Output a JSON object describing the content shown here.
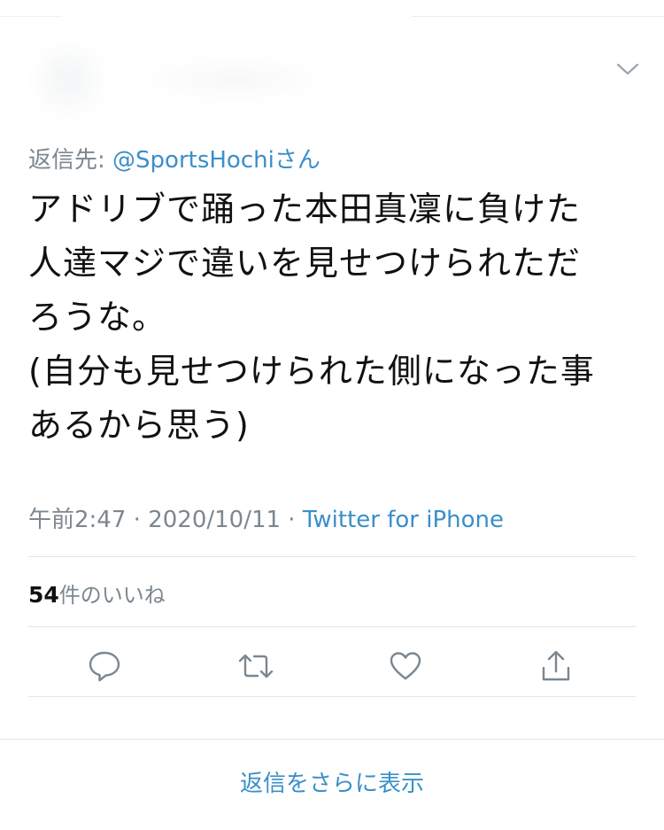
{
  "reply_to": {
    "prefix": "返信先: ",
    "handle": "@SportsHochiさん"
  },
  "tweet": {
    "text": "アドリブで踊った本田真凜に負けた\n人達マジで違いを見せつけられただ\nろうな。\n(自分も見せつけられた側になった事\nあるから思う)"
  },
  "meta": {
    "time": "午前2:47",
    "separator1": " · ",
    "date": "2020/10/11",
    "separator2": " · ",
    "source": "Twitter for iPhone"
  },
  "likes": {
    "count": "54",
    "label": "件のいいね"
  },
  "actions": {
    "reply_icon": "comment-icon",
    "retweet_icon": "retweet-icon",
    "like_icon": "heart-icon",
    "share_icon": "share-icon"
  },
  "more_replies": "返信をさらに表示",
  "colors": {
    "link": "#3a8fc9",
    "muted": "#7c878f",
    "text": "#111111",
    "divider": "#e1e6ea"
  }
}
